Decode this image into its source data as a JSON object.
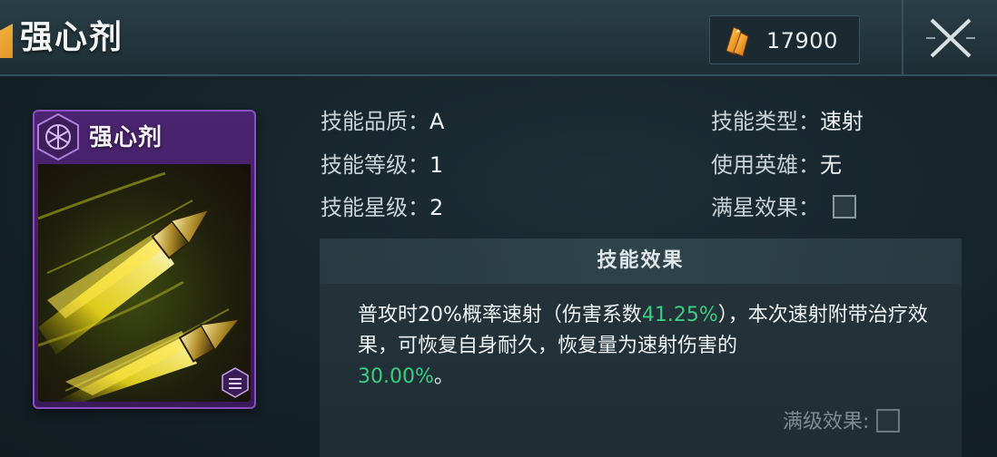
{
  "header": {
    "title": "强心剂",
    "currency": {
      "icon": "crystal-icon",
      "value": "17900"
    },
    "close_icon": "close-icon"
  },
  "card": {
    "title": "强心剂",
    "rarity_color": "#6b2fa3",
    "icon": "rocket-projectile-art"
  },
  "info": {
    "quality_label": "技能品质：",
    "quality_value": "A",
    "level_label": "技能等级：",
    "level_value": "1",
    "star_label": "技能星级：",
    "star_value": "2",
    "type_label": "技能类型：",
    "type_value": "速射",
    "hero_label": "使用英雄：",
    "hero_value": "无",
    "fullstar_label": "满星效果："
  },
  "effect": {
    "title": "技能效果",
    "text_1": "普攻时20%概率速射（伤害系数",
    "highlight_1": "41.25%",
    "text_2": "），本次速射附带治疗效果，可恢复自身耐久，恢复量为速射伤害的",
    "highlight_2": "30.00%",
    "text_3": "。",
    "highlight_color": "#3ecb83",
    "maxlevel_label": "满级效果:"
  }
}
